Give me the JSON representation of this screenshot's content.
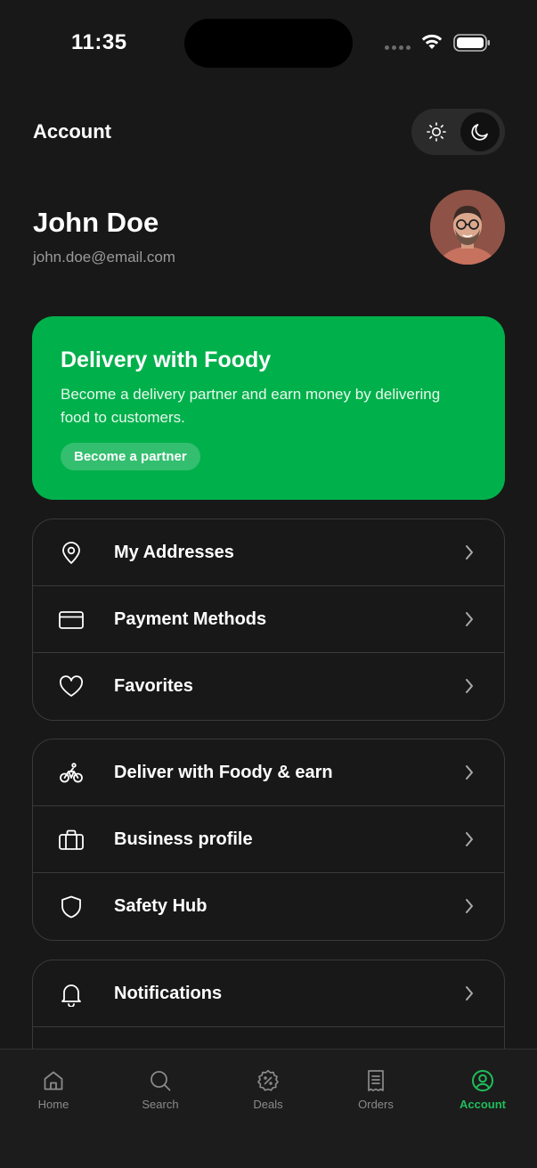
{
  "status_bar": {
    "time": "11:35"
  },
  "header": {
    "title": "Account",
    "theme_toggle": {
      "options": [
        "light",
        "dark"
      ],
      "selected": "dark"
    }
  },
  "profile": {
    "name": "John Doe",
    "email": "john.doe@email.com"
  },
  "promo": {
    "title": "Delivery with Foody",
    "text": "Become a delivery partner and earn money by delivering food to customers.",
    "button_label": "Become a partner",
    "color": "#00b04b"
  },
  "menu_groups": [
    {
      "items": [
        {
          "label": "My Addresses",
          "icon": "map-pin-icon"
        },
        {
          "label": "Payment Methods",
          "icon": "credit-card-icon"
        },
        {
          "label": "Favorites",
          "icon": "heart-icon"
        }
      ]
    },
    {
      "items": [
        {
          "label": "Deliver with Foody & earn",
          "icon": "bicycle-icon"
        },
        {
          "label": "Business profile",
          "icon": "briefcase-icon"
        },
        {
          "label": "Safety Hub",
          "icon": "shield-icon"
        }
      ]
    },
    {
      "items": [
        {
          "label": "Notifications",
          "icon": "bell-icon"
        }
      ]
    }
  ],
  "bottom_nav": {
    "items": [
      {
        "label": "Home",
        "icon": "home-icon"
      },
      {
        "label": "Search",
        "icon": "search-icon"
      },
      {
        "label": "Deals",
        "icon": "discount-badge-icon"
      },
      {
        "label": "Orders",
        "icon": "receipt-icon"
      },
      {
        "label": "Account",
        "icon": "user-circle-icon"
      }
    ],
    "active": "Account",
    "active_color": "#1fbe5a"
  }
}
